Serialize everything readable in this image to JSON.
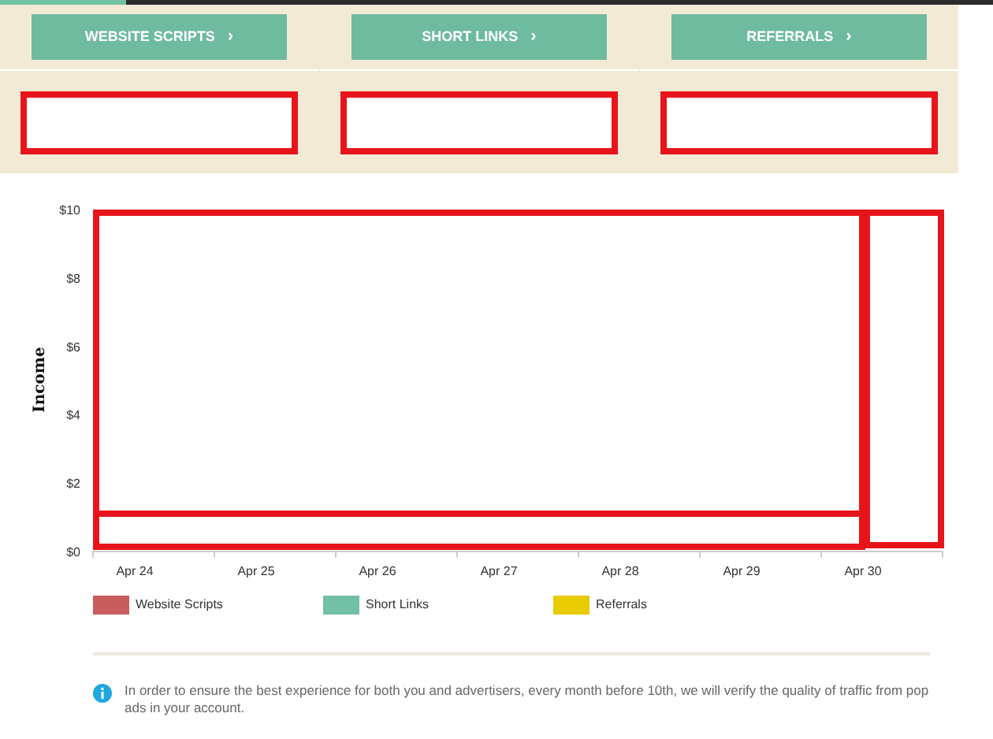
{
  "stat_buttons": [
    {
      "label": "WEBSITE SCRIPTS",
      "chevron": "›"
    },
    {
      "label": "SHORT LINKS",
      "chevron": "›"
    },
    {
      "label": "REFERRALS",
      "chevron": "›"
    }
  ],
  "chart": {
    "chart_data": {
      "type": "bar",
      "ylabel": "Income",
      "categories": [
        "Apr 24",
        "Apr 25",
        "Apr 26",
        "Apr 27",
        "Apr 28",
        "Apr 29",
        "Apr 30"
      ],
      "ylim": [
        0,
        10
      ],
      "yticks": [
        {
          "value": 0,
          "label": "$0"
        },
        {
          "value": 2,
          "label": "$2"
        },
        {
          "value": 4,
          "label": "$4"
        },
        {
          "value": 6,
          "label": "$6"
        },
        {
          "value": 8,
          "label": "$8"
        },
        {
          "value": 10,
          "label": "$10"
        }
      ],
      "series": [
        {
          "name": "Website Scripts",
          "color": "#c95c5c",
          "values": [
            null,
            null,
            null,
            null,
            null,
            null,
            null
          ]
        },
        {
          "name": "Short Links",
          "color": "#72c0a5",
          "values": [
            null,
            null,
            null,
            null,
            null,
            null,
            null
          ]
        },
        {
          "name": "Referrals",
          "color": "#e8cb00",
          "values": [
            null,
            null,
            null,
            null,
            null,
            null,
            null
          ]
        }
      ]
    }
  },
  "notice": {
    "text": "In order to ensure the best experience for both you and advertisers, every month before 10th, we will verify the quality of traffic from pop ads in your account."
  }
}
